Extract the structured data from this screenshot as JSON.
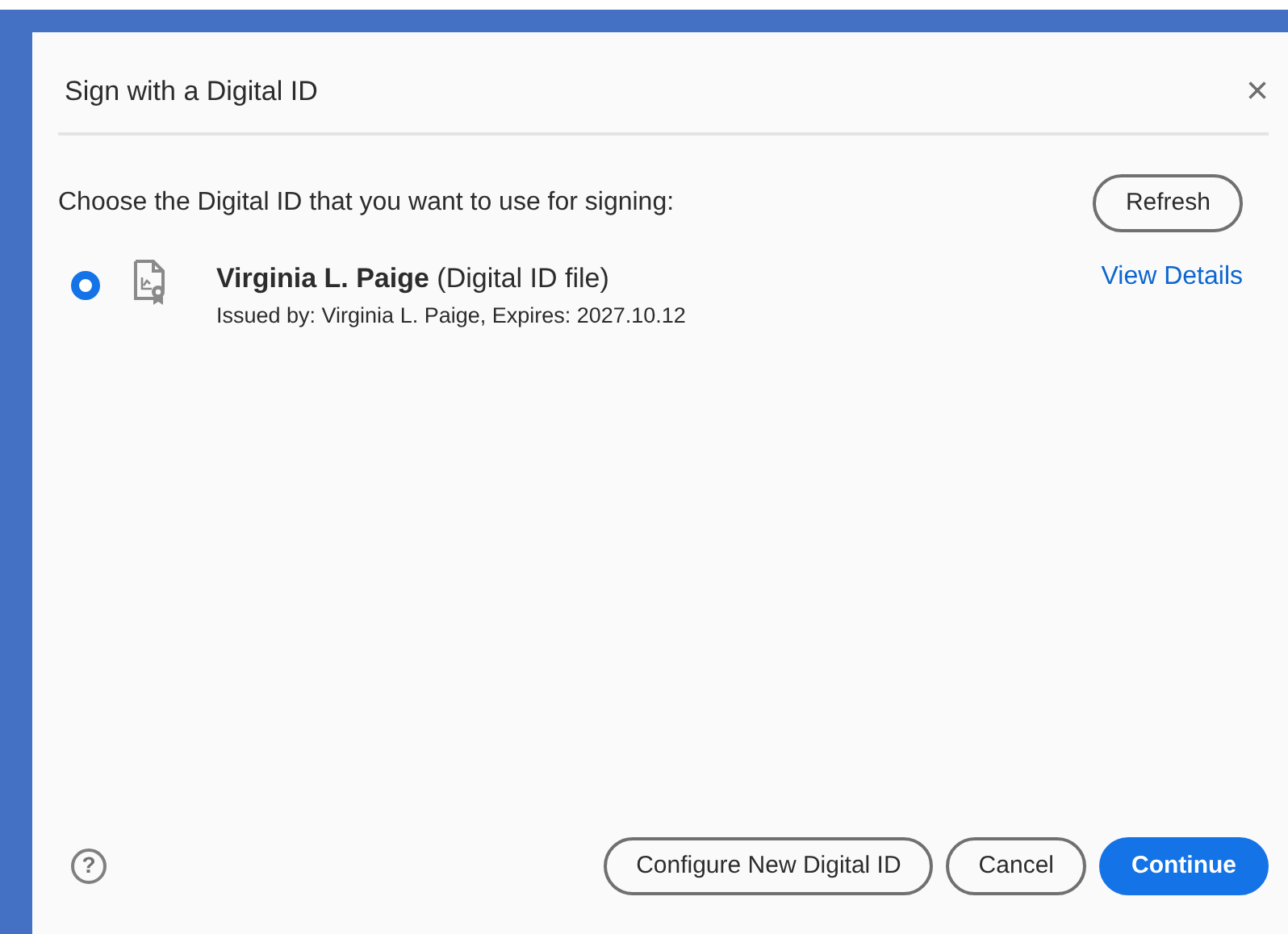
{
  "dialog": {
    "title": "Sign with a Digital ID",
    "close": "×"
  },
  "prompt": "Choose the Digital ID that you want to use for signing:",
  "refresh_button": "Refresh",
  "ids": [
    {
      "name": "**Virginia L. Paige** (Digital ID file)",
      "details": "Issued by: Virginia L. Paige, Expires: 2027.10.12",
      "link": "View Details",
      "selected": true
    }
  ],
  "help": "?",
  "buttons": [
    {
      "label": "Configure New Digital ID",
      "kind": "secondary"
    },
    {
      "label": "Cancel",
      "kind": "secondary"
    },
    {
      "label": "Continue",
      "kind": "primary"
    }
  ]
}
